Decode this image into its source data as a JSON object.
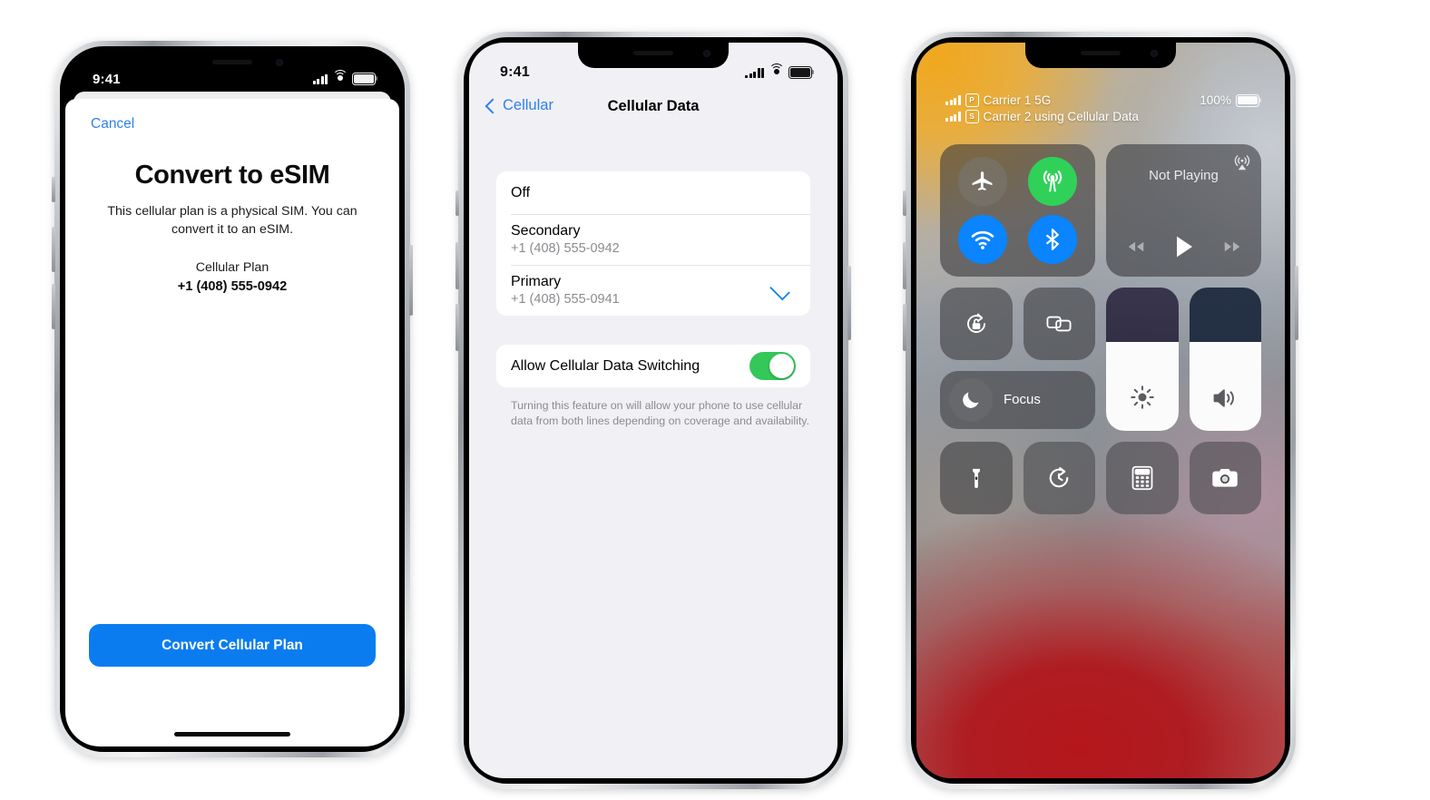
{
  "phone1": {
    "status_bar": {
      "time": "9:41",
      "signal_icon": "cellular-bars-icon",
      "wifi_icon": "wifi-icon",
      "battery_icon": "battery-full-icon"
    },
    "cancel_label": "Cancel",
    "title": "Convert to eSIM",
    "description": "This cellular plan is a physical SIM. You can convert it to an eSIM.",
    "plan_label": "Cellular Plan",
    "plan_number": "+1 (408) 555-0942",
    "cta_label": "Convert Cellular Plan",
    "accent_color": "#0b7cf0",
    "link_color": "#2f7ff0"
  },
  "phone2": {
    "status_bar": {
      "time": "9:41",
      "signal_icon": "dual-cellular-bars-icon",
      "wifi_icon": "wifi-icon",
      "battery_icon": "battery-full-icon"
    },
    "back_label": "Cellular",
    "nav_title": "Cellular Data",
    "lines": [
      {
        "title": "Off",
        "subtitle": "",
        "selected": false
      },
      {
        "title": "Secondary",
        "subtitle": "+1 (408) 555-0942",
        "selected": false
      },
      {
        "title": "Primary",
        "subtitle": "+1 (408) 555-0941",
        "selected": true
      }
    ],
    "switch_row": {
      "label": "Allow Cellular Data Switching",
      "value": "on"
    },
    "footnote": "Turning this feature on will allow your phone to use cellular data from both lines depending on coverage and availability.",
    "toggle_on_color": "#34c759",
    "check_color": "#0b7cf0"
  },
  "phone3": {
    "status_bar": {
      "carrier_lines": [
        {
          "badge": "P",
          "text": "Carrier 1 5G"
        },
        {
          "badge": "S",
          "text": "Carrier 2 using Cellular Data"
        }
      ],
      "battery_percent": "100%"
    },
    "connectivity": [
      {
        "name": "airplane-mode",
        "state": "off"
      },
      {
        "name": "cellular-data",
        "state": "on"
      },
      {
        "name": "wifi",
        "state": "on"
      },
      {
        "name": "bluetooth",
        "state": "on"
      }
    ],
    "now_playing": {
      "title": "Not Playing",
      "airplay_icon": "airplay-audio-icon",
      "controls": [
        "rewind-icon",
        "play-icon",
        "fast-forward-icon"
      ]
    },
    "middle_tiles": [
      {
        "name": "rotation-lock"
      },
      {
        "name": "screen-mirroring"
      }
    ],
    "focus_tile": {
      "label": "Focus",
      "icon": "moon-icon"
    },
    "sliders": [
      {
        "name": "brightness",
        "level_percent": 62,
        "icon": "sun-icon"
      },
      {
        "name": "volume",
        "level_percent": 62,
        "icon": "speaker-icon"
      }
    ],
    "bottom_tiles": [
      {
        "name": "flashlight"
      },
      {
        "name": "timer"
      },
      {
        "name": "calculator"
      },
      {
        "name": "camera"
      }
    ],
    "colors": {
      "green": "#30d158",
      "blue": "#0a84ff"
    }
  }
}
